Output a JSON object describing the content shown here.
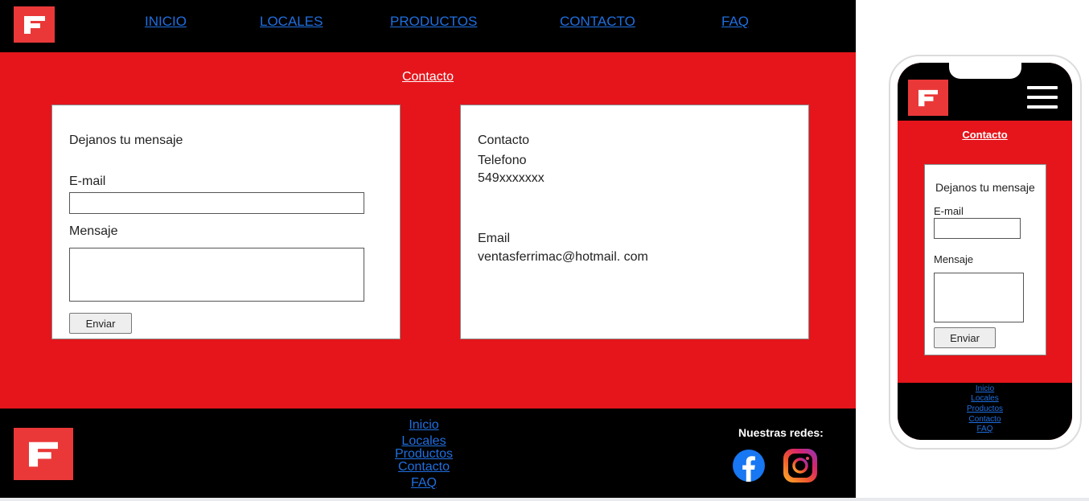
{
  "brand": {
    "logo_icon": "ferrimac-f-logo-icon",
    "accent": "#e5151b",
    "logo_bg": "#ea3838",
    "link_color": "#1f6fe0"
  },
  "nav": {
    "items": [
      "INICIO",
      "LOCALES",
      "PRODUCTOS",
      "CONTACTO",
      "FAQ"
    ]
  },
  "section_title": "Contacto",
  "form": {
    "heading": "Dejanos tu mensaje",
    "email_label": "E-mail",
    "email_value": "",
    "message_label": "Mensaje",
    "message_value": "",
    "submit_label": "Enviar"
  },
  "contact": {
    "heading": "Contacto",
    "phone_label": "Telefono",
    "phone_value": "549xxxxxxx",
    "email_label": "Email",
    "email_value": "ventasferrimac@hotmail. com"
  },
  "footer": {
    "links": [
      "Inicio",
      "Locales",
      "Productos",
      "Contacto",
      "FAQ"
    ],
    "social_label": "Nuestras redes:",
    "social_icons": [
      "facebook-icon",
      "instagram-icon"
    ]
  },
  "mobile": {
    "menu_icon": "hamburger-menu-icon",
    "section_title": "Contacto",
    "form": {
      "heading": "Dejanos tu mensaje",
      "email_label": "E-mail",
      "message_label": "Mensaje",
      "submit_label": "Enviar"
    },
    "footer_links": [
      "Inicio",
      "Locales",
      "Productos",
      "Contacto",
      "FAQ"
    ]
  }
}
